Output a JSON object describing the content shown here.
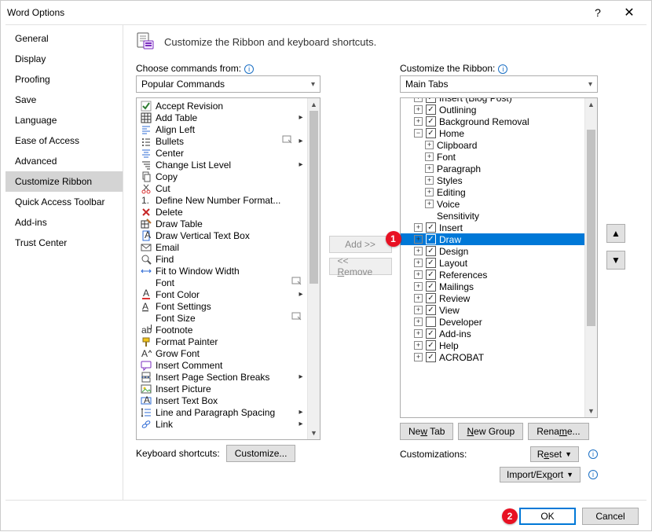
{
  "window": {
    "title": "Word Options"
  },
  "sidebar": {
    "items": [
      {
        "label": "General"
      },
      {
        "label": "Display"
      },
      {
        "label": "Proofing"
      },
      {
        "label": "Save"
      },
      {
        "label": "Language"
      },
      {
        "label": "Ease of Access"
      },
      {
        "label": "Advanced"
      },
      {
        "label": "Customize Ribbon",
        "selected": true
      },
      {
        "label": "Quick Access Toolbar"
      },
      {
        "label": "Add-ins"
      },
      {
        "label": "Trust Center"
      }
    ]
  },
  "heading": "Customize the Ribbon and keyboard shortcuts.",
  "choose_label": "Choose commands from:",
  "choose_value": "Popular Commands",
  "customize_label": "Customize the Ribbon:",
  "customize_value": "Main Tabs",
  "commands": [
    {
      "icon": "check-green",
      "label": "Accept Revision"
    },
    {
      "icon": "table",
      "label": "Add Table",
      "sub": true
    },
    {
      "icon": "align-left",
      "label": "Align Left"
    },
    {
      "icon": "bullets",
      "label": "Bullets",
      "sub": true,
      "popup": true
    },
    {
      "icon": "center",
      "label": "Center"
    },
    {
      "icon": "list-level",
      "label": "Change List Level",
      "sub": true
    },
    {
      "icon": "copy",
      "label": "Copy"
    },
    {
      "icon": "cut",
      "label": "Cut"
    },
    {
      "icon": "num-format",
      "label": "Define New Number Format..."
    },
    {
      "icon": "delete-x",
      "label": "Delete"
    },
    {
      "icon": "draw-table",
      "label": "Draw Table"
    },
    {
      "icon": "textbox-v",
      "label": "Draw Vertical Text Box"
    },
    {
      "icon": "email",
      "label": "Email"
    },
    {
      "icon": "find",
      "label": "Find"
    },
    {
      "icon": "fit-width",
      "label": "Fit to Window Width"
    },
    {
      "icon": "blank",
      "label": "Font",
      "popup": true
    },
    {
      "icon": "font-color",
      "label": "Font Color",
      "sub": true
    },
    {
      "icon": "font-settings",
      "label": "Font Settings"
    },
    {
      "icon": "blank",
      "label": "Font Size",
      "popup": true
    },
    {
      "icon": "footnote",
      "label": "Footnote"
    },
    {
      "icon": "format-painter",
      "label": "Format Painter"
    },
    {
      "icon": "grow-font",
      "label": "Grow Font"
    },
    {
      "icon": "comment",
      "label": "Insert Comment"
    },
    {
      "icon": "page-break",
      "label": "Insert Page  Section Breaks",
      "sub": true
    },
    {
      "icon": "picture",
      "label": "Insert Picture"
    },
    {
      "icon": "textbox",
      "label": "Insert Text Box"
    },
    {
      "icon": "line-spacing",
      "label": "Line and Paragraph Spacing",
      "sub": true
    },
    {
      "icon": "link",
      "label": "Link",
      "sub": true
    }
  ],
  "tree": {
    "top_cut_item": {
      "indent": 1,
      "expander": "plus",
      "checked": true,
      "label": "Insert (Blog Post)"
    },
    "items": [
      {
        "indent": 1,
        "expander": "plus",
        "checked": true,
        "label": "Outlining"
      },
      {
        "indent": 1,
        "expander": "plus",
        "checked": true,
        "label": "Background Removal"
      },
      {
        "indent": 1,
        "expander": "minus",
        "checked": true,
        "label": "Home"
      },
      {
        "indent": 2,
        "expander": "plus",
        "checked": null,
        "label": "Clipboard"
      },
      {
        "indent": 2,
        "expander": "plus",
        "checked": null,
        "label": "Font"
      },
      {
        "indent": 2,
        "expander": "plus",
        "checked": null,
        "label": "Paragraph"
      },
      {
        "indent": 2,
        "expander": "plus",
        "checked": null,
        "label": "Styles"
      },
      {
        "indent": 2,
        "expander": "plus",
        "checked": null,
        "label": "Editing"
      },
      {
        "indent": 2,
        "expander": "plus",
        "checked": null,
        "label": "Voice"
      },
      {
        "indent": 2,
        "expander": "blank",
        "checked": null,
        "label": "Sensitivity"
      },
      {
        "indent": 1,
        "expander": "plus",
        "checked": true,
        "label": "Insert"
      },
      {
        "indent": 1,
        "expander": "plus",
        "checked": true,
        "label": "Draw",
        "selected": true
      },
      {
        "indent": 1,
        "expander": "plus",
        "checked": true,
        "label": "Design"
      },
      {
        "indent": 1,
        "expander": "plus",
        "checked": true,
        "label": "Layout"
      },
      {
        "indent": 1,
        "expander": "plus",
        "checked": true,
        "label": "References"
      },
      {
        "indent": 1,
        "expander": "plus",
        "checked": true,
        "label": "Mailings"
      },
      {
        "indent": 1,
        "expander": "plus",
        "checked": true,
        "label": "Review"
      },
      {
        "indent": 1,
        "expander": "plus",
        "checked": true,
        "label": "View"
      },
      {
        "indent": 1,
        "expander": "plus",
        "checked": false,
        "label": "Developer"
      },
      {
        "indent": 1,
        "expander": "plus",
        "checked": true,
        "label": "Add-ins"
      },
      {
        "indent": 1,
        "expander": "plus",
        "checked": true,
        "label": "Help"
      },
      {
        "indent": 1,
        "expander": "plus",
        "checked": true,
        "label": "ACROBAT"
      }
    ]
  },
  "mid_buttons": {
    "add": "Add >>",
    "remove": "<< Remove"
  },
  "keyboard_shortcuts_label": "Keyboard shortcuts:",
  "customize_btn": "Customize...",
  "tabs_buttons": {
    "new_tab": "New Tab",
    "new_group": "New Group",
    "rename": "Rename..."
  },
  "customizations_label": "Customizations:",
  "reset_btn": "Reset",
  "import_export_btn": "Import/Export",
  "footer": {
    "ok": "OK",
    "cancel": "Cancel"
  },
  "annotations": {
    "one": "1",
    "two": "2"
  }
}
